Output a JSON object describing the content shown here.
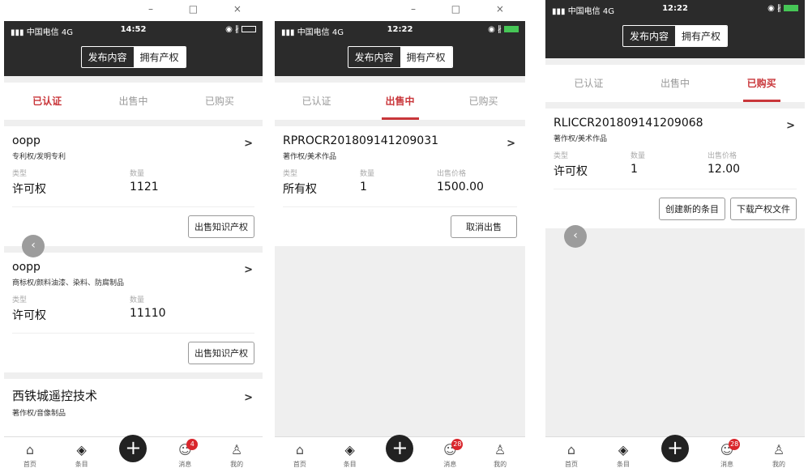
{
  "window": {
    "controls": "– □ ×"
  },
  "phone1": {
    "carrier": "中国电信 4G",
    "time": "14:52",
    "status_icons": "◉ ∦",
    "segment": [
      "发布内容",
      "拥有产权"
    ],
    "tabs": [
      "已认证",
      "出售中",
      "已购买"
    ],
    "cards": [
      {
        "title": "oopp",
        "sub": "专利权/发明专利",
        "label_type": "类型",
        "label_qty": "数量",
        "type": "许可权",
        "qty": "1121",
        "action": "出售知识产权"
      },
      {
        "title": "oopp",
        "sub": "商标权/颜料油漆、染料、防腐制品",
        "label_type": "类型",
        "label_qty": "数量",
        "type": "许可权",
        "qty": "11110",
        "action": "出售知识产权"
      },
      {
        "title": "西铁城遥控技术",
        "sub": "著作权/音像制品"
      }
    ],
    "badge": "4"
  },
  "phone2": {
    "carrier": "中国电信 4G",
    "time": "12:22",
    "status_icons": "◉ ∦",
    "segment": [
      "发布内容",
      "拥有产权"
    ],
    "tabs": [
      "已认证",
      "出售中",
      "已购买"
    ],
    "card": {
      "title": "RPROCR201809141209031",
      "sub": "著作权/美术作品",
      "label_type": "类型",
      "label_qty": "数量",
      "label_price": "出售价格",
      "type": "所有权",
      "qty": "1",
      "price": "1500.00",
      "action": "取消出售"
    },
    "badge": "28"
  },
  "phone3": {
    "carrier": "中国电信 4G",
    "time": "12:22",
    "status_icons": "◉ ∦",
    "segment": [
      "发布内容",
      "拥有产权"
    ],
    "tabs": [
      "已认证",
      "出售中",
      "已购买"
    ],
    "card": {
      "title": "RLICCR201809141209068",
      "sub": "著作权/美术作品",
      "label_type": "类型",
      "label_qty": "数量",
      "label_price": "出售价格",
      "type": "许可权",
      "qty": "1",
      "price": "12.00",
      "action1": "创建新的条目",
      "action2": "下载产权文件"
    },
    "badge": "28"
  },
  "tabbar": {
    "home": "首页",
    "items": "条目",
    "messages": "消息",
    "mine": "我的"
  },
  "colors": {
    "accent": "#c9363a",
    "header": "#2b2b2b"
  }
}
